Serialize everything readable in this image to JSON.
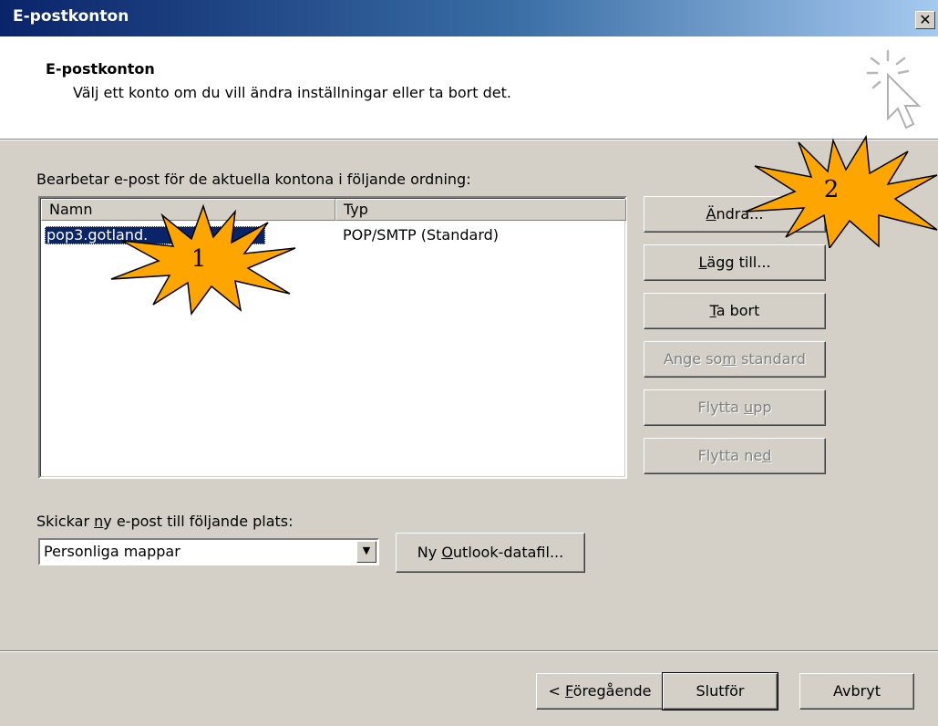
{
  "window": {
    "title": "E-postkonton",
    "close_label": "✕"
  },
  "header": {
    "title": "E-postkonton",
    "subtitle": "Välj ett konto om du vill ändra inställningar eller ta bort det."
  },
  "accounts": {
    "label": "Bearbetar e-post för de aktuella kontona i följande ordning:",
    "columns": [
      "Namn",
      "Typ"
    ],
    "rows": [
      {
        "name": "pop3.gotland.",
        "type": "POP/SMTP (Standard)"
      }
    ]
  },
  "buttons": {
    "andra": {
      "pre": "",
      "key": "Ä",
      "post": "ndra..."
    },
    "lagg": {
      "pre": "",
      "key": "L",
      "post": "ägg till..."
    },
    "tabort": {
      "pre": "",
      "key": "T",
      "post": "a bort"
    },
    "standard": {
      "pre": "Ange so",
      "key": "m",
      "post": " standard"
    },
    "upp": {
      "pre": "Flytta ",
      "key": "u",
      "post": "pp"
    },
    "ned": {
      "pre": "Flytta ne",
      "key": "d",
      "post": ""
    }
  },
  "deliver": {
    "label_pre": "Skickar ",
    "label_key": "n",
    "label_post": "y e-post till följande plats:",
    "selected": "Personliga mappar",
    "new_file_pre": "Ny ",
    "new_file_key": "O",
    "new_file_post": "utlook-datafil..."
  },
  "footer": {
    "prev_pre": "< ",
    "prev_key": "F",
    "prev_post": "öregående",
    "finish": "Slutför",
    "cancel": "Avbryt"
  },
  "annotations": {
    "star1": "1",
    "star2": "2",
    "color": "#ffa500"
  },
  "icons": {
    "wizard": "sparkle-cursor-icon",
    "combo_arrow": "▼"
  }
}
